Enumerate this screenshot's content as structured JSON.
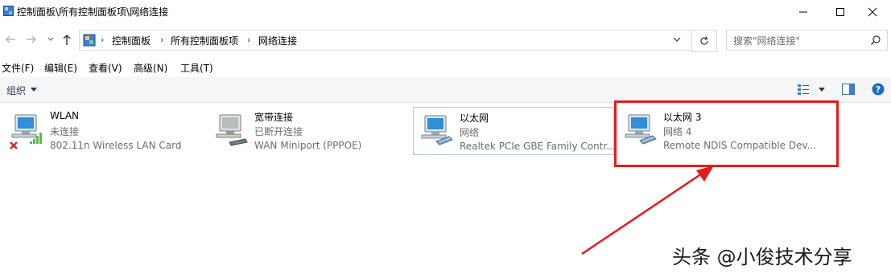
{
  "window": {
    "title": "控制面板\\所有控制面板项\\网络连接",
    "icons": {
      "app": "control-panel-icon",
      "minimize": "minimize-icon",
      "maximize": "maximize-icon",
      "close": "close-icon"
    }
  },
  "address": {
    "breadcrumbs": [
      "控制面板",
      "所有控制面板项",
      "网络连接"
    ],
    "search_placeholder": "搜索\"网络连接\""
  },
  "menu": [
    "文件(F)",
    "编辑(E)",
    "查看(V)",
    "高级(N)",
    "工具(T)"
  ],
  "commandbar": {
    "organize": "组织"
  },
  "connections": [
    {
      "name": "WLAN",
      "status": "未连接",
      "device": "802.11n Wireless LAN Card",
      "icon": "wireless-network-icon",
      "state_icon": "disconnected-x-icon"
    },
    {
      "name": "宽带连接",
      "status": "已断开连接",
      "device": "WAN Miniport (PPPOE)",
      "icon": "broadband-connection-icon"
    },
    {
      "name": "以太网",
      "status": "网络",
      "device": "Realtek PCIe GBE Family Contr...",
      "icon": "ethernet-network-icon"
    },
    {
      "name": "以太网 3",
      "status": "网络 4",
      "device": "Remote NDIS Compatible Dev...",
      "icon": "ethernet-network-icon"
    }
  ],
  "annotation": {
    "highlight_color": "#e31b1b"
  },
  "watermark": "头条 @小俊技术分享"
}
